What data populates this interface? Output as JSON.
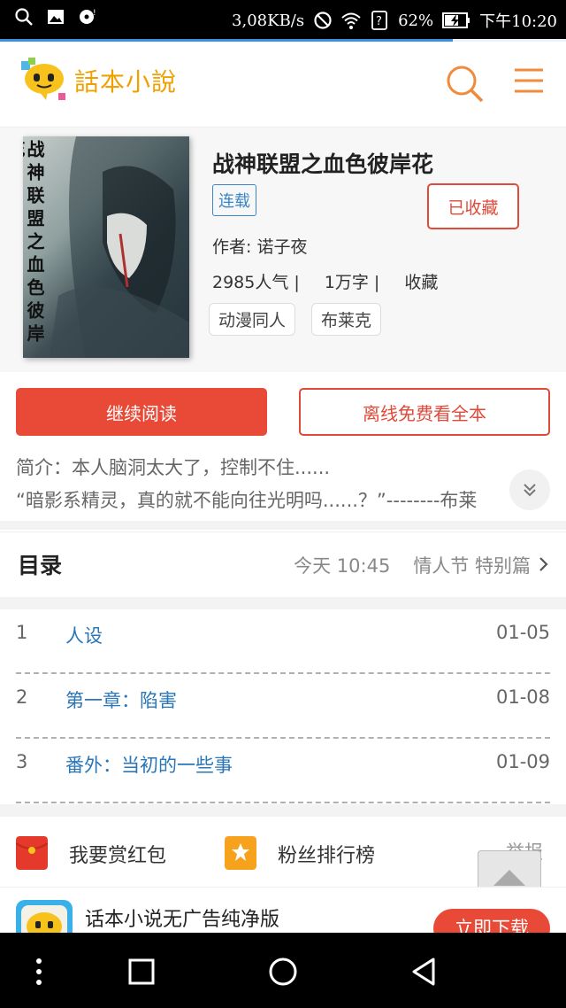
{
  "status_bar": {
    "net_speed": "3,08KB/s",
    "battery": "62%",
    "time": "下午10:20"
  },
  "page_progress": 0.8,
  "header": {
    "logo_text": "話本小說",
    "icons": [
      "search-icon",
      "menu-icon"
    ]
  },
  "book": {
    "title": "战神联盟之血色彼岸花",
    "cover_title": "战神联盟之血色彼岸花",
    "status_tag": "连载",
    "favorite_label": "已收藏",
    "author": "作者: 诺子夜",
    "popularity": "2985人气 |",
    "word_count": "1万字 |",
    "collect": "收藏",
    "tags": [
      "动漫同人",
      "布莱克"
    ]
  },
  "buttons": {
    "continue": "继续阅读",
    "offline": "离线免费看全本"
  },
  "intro": {
    "line1": "简介：本人脑洞太大了，控制不住......",
    "line2": "“暗影系精灵，真的就不能向往光明吗......？”--------布莱"
  },
  "toc": {
    "title": "目录",
    "latest_time": "今天 10:45",
    "latest_chapter": "情人节 特别篇",
    "chapters": [
      {
        "num": "1",
        "name": "人设",
        "date": "01-05"
      },
      {
        "num": "2",
        "name": "第一章：陷害",
        "date": "01-08"
      },
      {
        "num": "3",
        "name": "番外：当初的一些事",
        "date": "01-09"
      }
    ]
  },
  "actions": {
    "reward": "我要赏红包",
    "fans_rank": "粉丝排行榜",
    "report": "举报"
  },
  "banner": {
    "text": "话本小说无广告纯净版",
    "download": "立即下载"
  },
  "colors": {
    "accent_red": "#e84a37",
    "link_blue": "#2a76b8",
    "logo_orange": "#f0a000",
    "header_icon_orange": "#f08a3c"
  }
}
